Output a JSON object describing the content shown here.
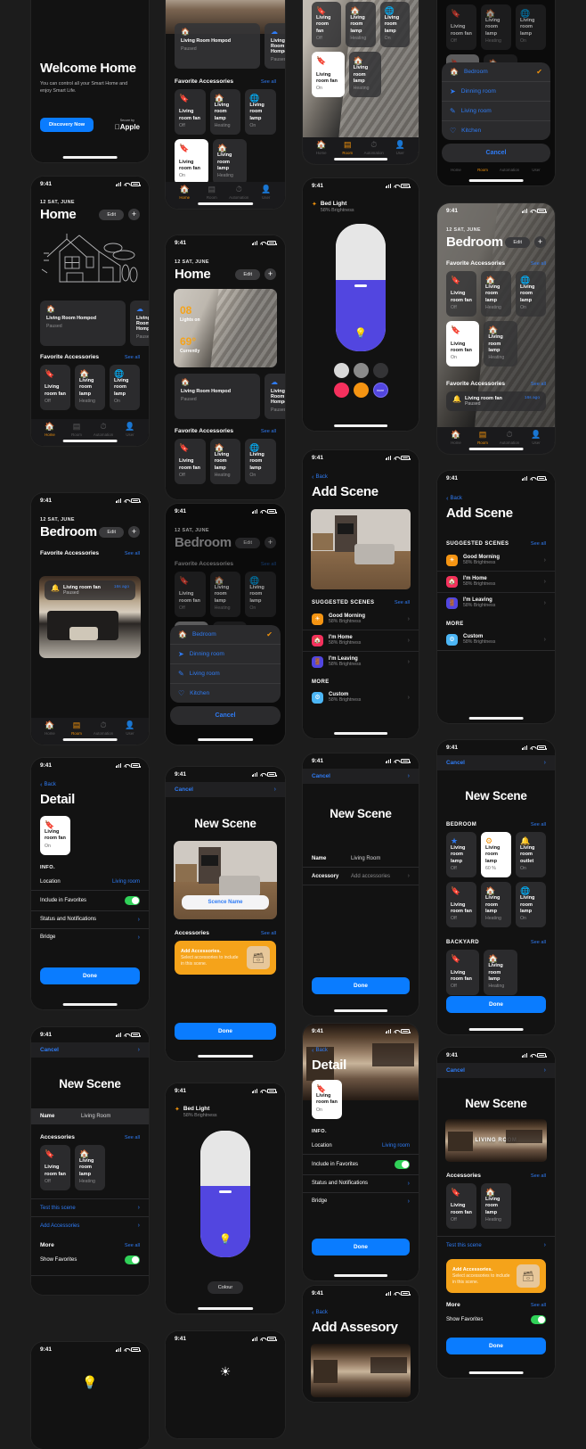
{
  "meta": {
    "status_time": "9:41",
    "date": "12 SAT, JUNE"
  },
  "common": {
    "edit": "Edit",
    "plus": "+",
    "see_all": "See all",
    "favorite_accessories": "Favorite Accessories",
    "accessories": "Accessories",
    "done": "Done",
    "cancel": "Cancel",
    "back": "Back",
    "more": "More"
  },
  "tabbar": {
    "items": [
      {
        "label": "Home",
        "icon": "home-icon",
        "active": true
      },
      {
        "label": "Room",
        "icon": "grid-icon",
        "active": false
      },
      {
        "label": "Automation",
        "icon": "clock-icon",
        "active": false
      },
      {
        "label": "User",
        "icon": "person-icon",
        "active": false
      }
    ],
    "items_room_active": [
      {
        "label": "Home",
        "icon": "home-icon",
        "active": false
      },
      {
        "label": "Room",
        "icon": "grid-icon",
        "active": true
      },
      {
        "label": "Automation",
        "icon": "clock-icon",
        "active": false
      },
      {
        "label": "User",
        "icon": "person-icon",
        "active": false
      }
    ]
  },
  "welcome": {
    "title": "Welcome Home",
    "subtitle": "You can control all your Smart Home and enjoy Smart Life.",
    "cta": "Discovery Now",
    "secure_label": "Secure by",
    "brand": "Apple"
  },
  "home": {
    "title": "Home",
    "lights_count": "08",
    "lights_label": "Lights on",
    "temperature": "69°",
    "temperature_label": "Currently",
    "status_cards": [
      {
        "name": "Living Room Hompod",
        "status": "Paused",
        "icon": "homepod-icon"
      },
      {
        "name": "Living Room Hompod",
        "status": "Paused",
        "icon": "cloud-icon"
      }
    ],
    "favorites": [
      {
        "name": "Living room fan",
        "status": "Off",
        "icon": "bookmark-icon",
        "selected": false
      },
      {
        "name": "Living room lamp",
        "status": "Heating",
        "icon": "house-icon",
        "selected": false
      },
      {
        "name": "Living room lamp",
        "status": "On",
        "icon": "globe-icon",
        "selected": false
      }
    ],
    "favorites_row2": [
      {
        "name": "Living room fan",
        "status": "On",
        "icon": "bookmark-icon",
        "selected": true
      },
      {
        "name": "Living room lamp",
        "status": "Heating",
        "icon": "house-icon",
        "selected": false
      }
    ]
  },
  "bedroom": {
    "title": "Bedroom",
    "overlay_card": {
      "name": "Living room fan",
      "status": "Paused",
      "ago": "16s ago"
    }
  },
  "room_picker": {
    "items": [
      {
        "label": "Bedroom",
        "icon": "homepod-icon",
        "checked": true
      },
      {
        "label": "Dinning room",
        "icon": "paperplane-icon",
        "checked": false
      },
      {
        "label": "Living room",
        "icon": "compose-icon",
        "checked": false
      },
      {
        "label": "Kitchen",
        "icon": "heart-icon",
        "checked": false
      }
    ],
    "cancel": "Cancel"
  },
  "bed_light": {
    "title": "Bed Light",
    "subtitle": "58% Brightness",
    "colour_label": "Colour",
    "swatches_row1": [
      "#d8d8d8",
      "#8a8a8a",
      "#343436"
    ],
    "swatches_row2": [
      "#f5305d",
      "#f59412",
      "#5246e0"
    ],
    "more_label": "more"
  },
  "detail": {
    "title": "Detail",
    "device": {
      "name": "Living room fan",
      "status": "On",
      "icon": "bookmark-icon"
    },
    "info_label": "INFO.",
    "rows": [
      {
        "label": "Location",
        "value": "Living room",
        "type": "value"
      },
      {
        "label": "Include in Favorites",
        "value": "",
        "type": "toggle"
      },
      {
        "label": "Status and Notifications",
        "value": "",
        "type": "chevron"
      },
      {
        "label": "Bridge",
        "value": "",
        "type": "chevron"
      }
    ],
    "done": "Done"
  },
  "add_scene": {
    "title": "Add Scene",
    "suggested_label": "SUGGESTED SCENES",
    "more_label": "MORE",
    "suggested": [
      {
        "name": "Good Morning",
        "sub": "58% Brightness",
        "color": "#f59412",
        "icon": "sun-icon"
      },
      {
        "name": "I'm Home",
        "sub": "58% Brightness",
        "color": "#f5305d",
        "icon": "house-icon"
      },
      {
        "name": "I'm Leaving",
        "sub": "58% Brightness",
        "color": "#5246e0",
        "icon": "door-icon"
      }
    ],
    "more": [
      {
        "name": "Custom",
        "sub": "58% Brightness",
        "color": "#4cb6f5",
        "icon": "gear-icon"
      }
    ]
  },
  "new_scene": {
    "title": "New Scene",
    "scene_name_placeholder": "Scence Name",
    "name_label": "Name",
    "name_value": "Living Room",
    "accessory_label": "Accessory",
    "accessory_value": "Add accessories",
    "add_accessories_title": "Add Accessories.",
    "add_accessories_desc": "Select accessories to include in this scene.",
    "test_scene": "Test this scene",
    "add_accessories_link": "Add Accessories",
    "show_favorites": "Show Favorites",
    "image_label": "LIVING ROOM",
    "done": "Done",
    "accessories": [
      {
        "name": "Living room fan",
        "status": "Off",
        "icon": "bookmark-icon",
        "selected": false
      },
      {
        "name": "Living room lamp",
        "status": "Heating",
        "icon": "house-icon",
        "selected": false
      }
    ],
    "bedroom_label": "BEDROOM",
    "backyard_label": "BACKYARD",
    "bedroom_accessories": [
      {
        "name": "Living room lamp",
        "status": "Off",
        "icon": "star-icon",
        "selected": false
      },
      {
        "name": "Living room lamp",
        "status": "60 %",
        "icon": "gear-icon",
        "selected": true
      },
      {
        "name": "Living room outlet",
        "status": "On",
        "icon": "bell-icon",
        "selected": false
      },
      {
        "name": "Living room fan",
        "status": "Off",
        "icon": "bookmark-icon",
        "selected": false
      },
      {
        "name": "Living room lamp",
        "status": "Heating",
        "icon": "house-icon",
        "selected": false
      },
      {
        "name": "Living room lamp",
        "status": "On",
        "icon": "globe-icon",
        "selected": false
      }
    ],
    "backyard_accessories": [
      {
        "name": "Living room fan",
        "status": "Off",
        "icon": "bookmark-icon",
        "selected": false
      },
      {
        "name": "Living room lamp",
        "status": "Heating",
        "icon": "house-icon",
        "selected": false
      }
    ]
  },
  "add_accessory": {
    "title": "Add Assesory"
  }
}
